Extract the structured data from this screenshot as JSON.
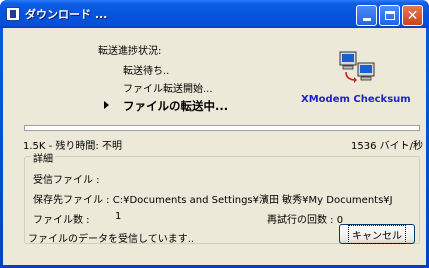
{
  "window": {
    "title": "ダウンロード ...",
    "icon": "app-window-icon"
  },
  "status": {
    "heading": "転送進捗状況:",
    "steps": [
      "転送待ち..",
      "ファイル転送開始...",
      "ファイルの転送中..."
    ],
    "current_step_indicator": "triangle-arrow-icon"
  },
  "protocol": {
    "icon": "computers-transfer-icon",
    "label": "XModem Checksum"
  },
  "progress": {
    "fraction": 0.0
  },
  "stats": {
    "left": "1.5K - 残り時間: 不明",
    "right": "1536 バイト/秒"
  },
  "details": {
    "legend": "詳細",
    "received_file_label": "受信ファイル :",
    "save_path": "保存先ファイル : C:¥Documents and Settings¥濱田 敏秀¥My Documents¥J",
    "file_count_label": "ファイル数 :",
    "file_count": "1",
    "retry_text": "再試行の回数 : 0"
  },
  "footer": {
    "message": "ファイルのデータを受信しています..",
    "cancel_label": "キャンセル"
  },
  "colors": {
    "titlebar": "#0550d6",
    "client": "#ece9d8",
    "protocol_text": "#1e22c8"
  }
}
